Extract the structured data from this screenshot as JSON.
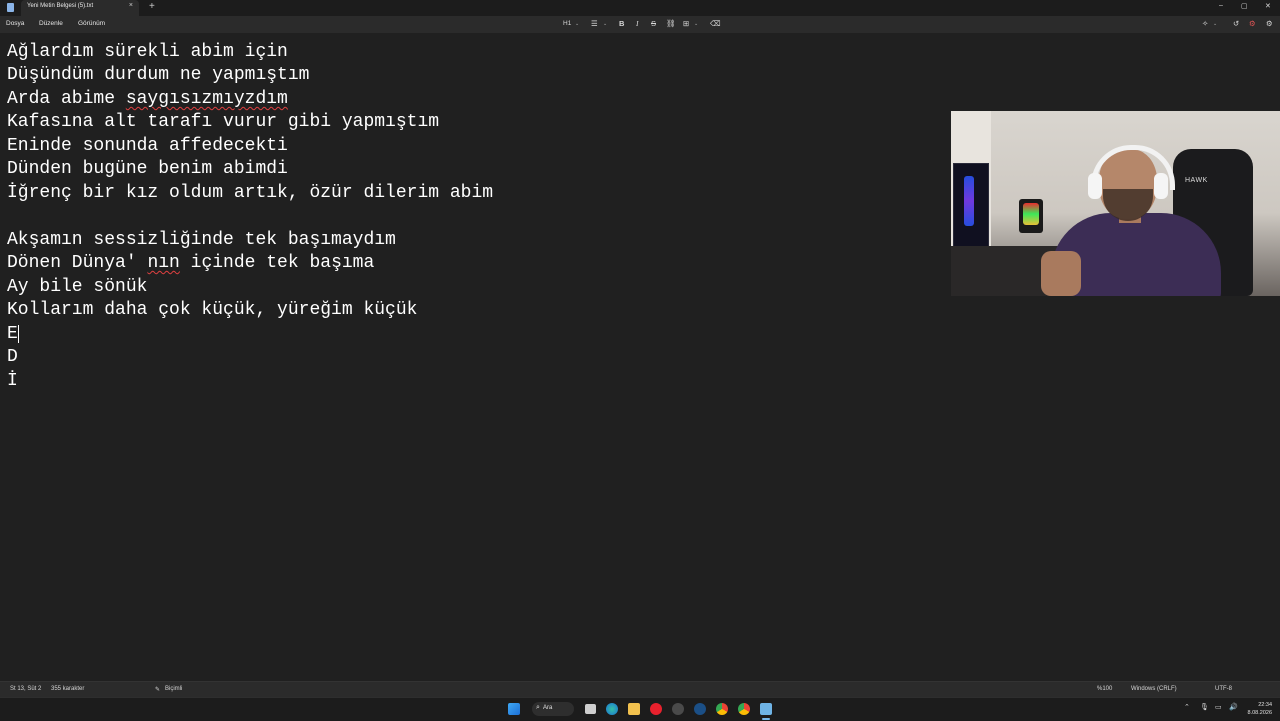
{
  "window": {
    "tab_title": "Yeni Metin Belgesi (5).txt",
    "close_tab": "×",
    "new_tab": "+",
    "minimize": "–",
    "maximize": "▢",
    "close": "✕"
  },
  "menu": {
    "file": "Dosya",
    "edit": "Düzenle",
    "view": "Görünüm"
  },
  "toolbar": {
    "heading": "H1",
    "heading_caret": "⌄",
    "list": "☰",
    "list_caret": "⌄",
    "bold": "B",
    "italic": "I",
    "strikethrough": "S",
    "link": "⛓",
    "table": "⊞",
    "table_caret": "⌄",
    "clear_format": "⌫",
    "copilot": "✧",
    "copilot_caret": "⌄",
    "history": "↺",
    "settings": "⚙"
  },
  "editor": {
    "lines": [
      "Ağlardım sürekli abim için",
      "Düşündüm durdum ne yapmıştım",
      "Arda abime saygısızmıyzdım",
      "Kafasına alt tarafı vurur gibi yapmıştım",
      "Eninde sonunda affedecekti",
      "Dünden bugüne benim abimdi",
      "İğrenç bir kız oldum artık, özür dilerim abim",
      "",
      "Akşamın sessizliğinde tek başımaydım",
      "Dönen Dünya' nın içinde tek başıma",
      "Ay bile sönük",
      "Kollarım daha çok küçük, yüreğim küçük",
      "E",
      "D",
      "İ"
    ],
    "line3_prefix": "Arda abime ",
    "line3_misspelled": "saygısızmıyzdım",
    "line10_prefix": "Dönen Dünya' ",
    "line10_misspelled": "nın",
    "line10_suffix": " içinde tek başıma"
  },
  "webcam": {
    "chair_logo": "HAWK"
  },
  "statusbar": {
    "position": "St 13, Süt 2",
    "char_count": "355 karakter",
    "format_icon": "✎",
    "format": "Biçimli",
    "zoom": "%100",
    "line_ending": "Windows (CRLF)",
    "encoding": "UTF-8"
  },
  "taskbar": {
    "search_label": "Ara",
    "search_icon": "⌕",
    "tray_chevron": "⌃",
    "time": "22:34",
    "date": "8.08.2026"
  },
  "colors": {
    "editor_bg": "#202020",
    "chrome_bg": "#2b2b2b",
    "text": "#ffffff",
    "spell_error": "#e04040",
    "accent": "#76b9ed"
  }
}
